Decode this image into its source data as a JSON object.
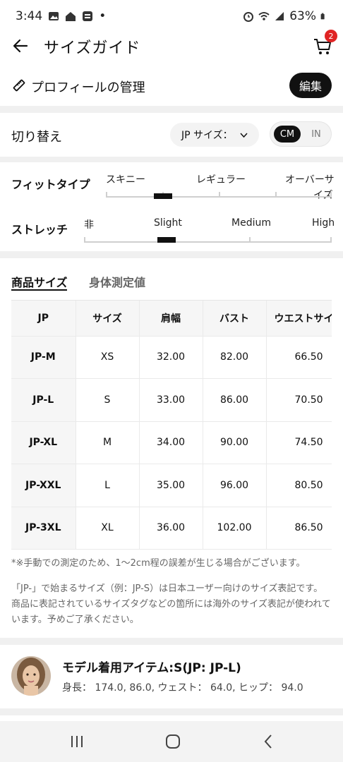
{
  "status": {
    "time": "3:44",
    "battery": "63%",
    "dot": "•"
  },
  "header": {
    "title": "サイズガイド",
    "cart_badge": "2"
  },
  "profile": {
    "label": "プロフィールの管理",
    "edit_label": "編集"
  },
  "switcher": {
    "label": "切り替え",
    "size_select": "JP サイズ：",
    "unit_cm": "CM",
    "unit_in": "IN",
    "selected_unit": "CM"
  },
  "fit": {
    "label": "フィットタイプ",
    "options": [
      "スキニー",
      "レギュラー",
      "オーバーサ",
      "イズ"
    ],
    "level": 0.25
  },
  "stretch": {
    "label": "ストレッチ",
    "options": [
      "非",
      "Slight",
      "Medium",
      "High"
    ],
    "level": 0.33
  },
  "tabs": {
    "product": "商品サイズ",
    "body": "身体測定値",
    "active": "product"
  },
  "table": {
    "headers": [
      "JP",
      "サイズ",
      "肩幅",
      "バスト",
      "ウエストサイ"
    ],
    "rows": [
      [
        "JP-M",
        "XS",
        "32.00",
        "82.00",
        "66.50"
      ],
      [
        "JP-L",
        "S",
        "33.00",
        "86.00",
        "70.50"
      ],
      [
        "JP-XL",
        "M",
        "34.00",
        "90.00",
        "74.50"
      ],
      [
        "JP-XXL",
        "L",
        "35.00",
        "96.00",
        "80.50"
      ],
      [
        "JP-3XL",
        "XL",
        "36.00",
        "102.00",
        "86.50"
      ]
    ]
  },
  "notes": {
    "note1": "*※手動での測定のため、1〜2cm程の誤差が生じる場合がございます。",
    "note2": "「JP-」で始まるサイズ（例：JP-S）は日本ユーザー向けのサイズ表記です。商品に表記されているサイズタグなどの箇所には海外のサイズ表記が使われています。予めご了承ください。"
  },
  "model": {
    "title": "モデル着用アイテム:S(JP: JP-L)",
    "measurements": "身長： 174.0,  86.0,  ウェスト： 64.0,  ヒップ： 94.0"
  },
  "colors": {
    "accent": "#111111",
    "badge": "#e02424",
    "divider": "#f0f0f0"
  },
  "icons": [
    "back-arrow-icon",
    "cart-icon",
    "ruler-icon",
    "chevron-down-icon",
    "recent-apps-icon",
    "home-icon",
    "back-icon"
  ]
}
